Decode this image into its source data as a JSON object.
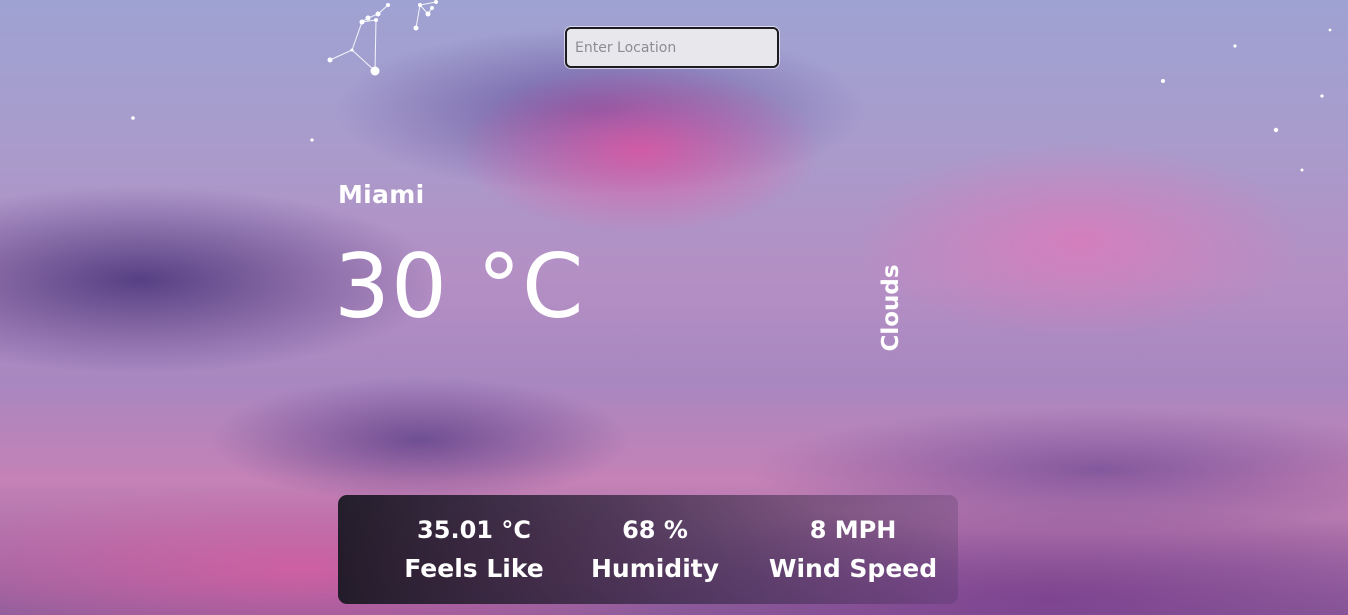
{
  "search": {
    "placeholder": "Enter Location",
    "value": ""
  },
  "weather": {
    "city": "Miami",
    "temperature": "30 °C",
    "condition": "Clouds"
  },
  "stats": {
    "feels_like": {
      "value": "35.01 °C",
      "label": "Feels Like"
    },
    "humidity": {
      "value": "68 %",
      "label": "Humidity"
    },
    "wind_speed": {
      "value": "8 MPH",
      "label": "Wind Speed"
    }
  },
  "theme": {
    "panel_color": "#16161f",
    "text_color": "#ffffff",
    "sky_pink": "#e85aa0",
    "sky_purple": "#6a4f96"
  },
  "icons": [
    "constellation-decoration",
    "star-decoration"
  ]
}
